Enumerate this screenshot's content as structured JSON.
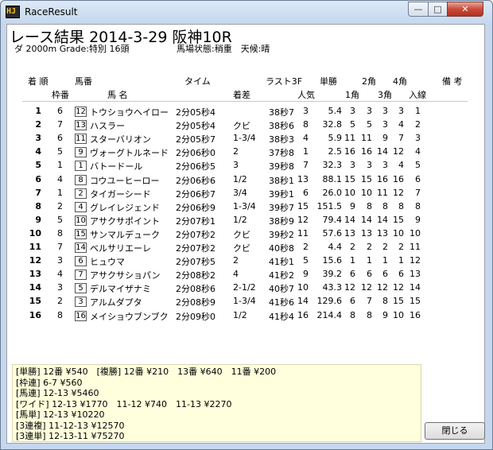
{
  "window": {
    "title": "RaceResult",
    "icon_text": "HJ"
  },
  "race": {
    "title": "レース結果 2014-3-29 阪神10R",
    "info_left": "ダ 2000m Grade:特別 16頭",
    "info_right": "馬場状態:稍重　天候:晴"
  },
  "headers": {
    "row1": [
      "着 順",
      "馬番",
      "タイム",
      "ラスト3F",
      "単勝",
      "2角",
      "4角",
      "備 考"
    ],
    "row2": [
      "枠番",
      "馬 名",
      "着差",
      "人気",
      "1角",
      "3角",
      "入線"
    ]
  },
  "results": [
    {
      "rank": "1",
      "waku": "6",
      "num": "12",
      "name": "トウショウヘイロー",
      "time": "2分05秒4",
      "margin": "",
      "last3f": "38秒7",
      "pop": "3",
      "odds": "5.4",
      "c1": "3",
      "c2": "3",
      "c3": "3",
      "c4": "3",
      "fin": "1"
    },
    {
      "rank": "2",
      "waku": "7",
      "num": "13",
      "name": "ハスラー",
      "time": "2分05秒4",
      "margin": "クビ",
      "last3f": "38秒6",
      "pop": "8",
      "odds": "32.8",
      "c1": "5",
      "c2": "5",
      "c3": "3",
      "c4": "4",
      "fin": "2"
    },
    {
      "rank": "3",
      "waku": "6",
      "num": "11",
      "name": "スターバリオン",
      "time": "2分05秒7",
      "margin": "1-3/4",
      "last3f": "38秒3",
      "pop": "4",
      "odds": "5.9",
      "c1": "11",
      "c2": "11",
      "c3": "9",
      "c4": "7",
      "fin": "3"
    },
    {
      "rank": "4",
      "waku": "5",
      "num": "9",
      "name": "ヴォーグトルネード",
      "time": "2分06秒0",
      "margin": "2",
      "last3f": "37秒8",
      "pop": "1",
      "odds": "2.5",
      "c1": "16",
      "c2": "16",
      "c3": "14",
      "c4": "12",
      "fin": "4"
    },
    {
      "rank": "5",
      "waku": "1",
      "num": "1",
      "name": "バトードール",
      "time": "2分06秒5",
      "margin": "3",
      "last3f": "39秒8",
      "pop": "7",
      "odds": "32.3",
      "c1": "3",
      "c2": "3",
      "c3": "3",
      "c4": "4",
      "fin": "5"
    },
    {
      "rank": "6",
      "waku": "4",
      "num": "8",
      "name": "コウユーヒーロー",
      "time": "2分06秒6",
      "margin": "1/2",
      "last3f": "38秒1",
      "pop": "13",
      "odds": "88.1",
      "c1": "15",
      "c2": "15",
      "c3": "16",
      "c4": "16",
      "fin": "6"
    },
    {
      "rank": "7",
      "waku": "1",
      "num": "2",
      "name": "タイガーシード",
      "time": "2分06秒7",
      "margin": "3/4",
      "last3f": "39秒1",
      "pop": "6",
      "odds": "26.0",
      "c1": "10",
      "c2": "10",
      "c3": "11",
      "c4": "12",
      "fin": "7"
    },
    {
      "rank": "8",
      "waku": "2",
      "num": "4",
      "name": "グレイレジェンド",
      "time": "2分06秒9",
      "margin": "1-3/4",
      "last3f": "39秒7",
      "pop": "15",
      "odds": "151.5",
      "c1": "9",
      "c2": "8",
      "c3": "8",
      "c4": "8",
      "fin": "8"
    },
    {
      "rank": "9",
      "waku": "5",
      "num": "10",
      "name": "アサクサポイント",
      "time": "2分07秒1",
      "margin": "1/2",
      "last3f": "38秒9",
      "pop": "12",
      "odds": "79.4",
      "c1": "14",
      "c2": "14",
      "c3": "14",
      "c4": "15",
      "fin": "9"
    },
    {
      "rank": "10",
      "waku": "8",
      "num": "15",
      "name": "サンマルデューク",
      "time": "2分07秒2",
      "margin": "クビ",
      "last3f": "39秒2",
      "pop": "11",
      "odds": "57.6",
      "c1": "13",
      "c2": "13",
      "c3": "13",
      "c4": "10",
      "fin": "10"
    },
    {
      "rank": "11",
      "waku": "7",
      "num": "14",
      "name": "ベルサリエーレ",
      "time": "2分07秒2",
      "margin": "クビ",
      "last3f": "40秒8",
      "pop": "2",
      "odds": "4.4",
      "c1": "2",
      "c2": "2",
      "c3": "2",
      "c4": "2",
      "fin": "11"
    },
    {
      "rank": "12",
      "waku": "3",
      "num": "6",
      "name": "ヒュウマ",
      "time": "2分07秒5",
      "margin": "2",
      "last3f": "41秒1",
      "pop": "5",
      "odds": "15.6",
      "c1": "1",
      "c2": "1",
      "c3": "1",
      "c4": "1",
      "fin": "12"
    },
    {
      "rank": "13",
      "waku": "4",
      "num": "7",
      "name": "アサクサショパン",
      "time": "2分08秒2",
      "margin": "4",
      "last3f": "41秒2",
      "pop": "9",
      "odds": "39.2",
      "c1": "6",
      "c2": "6",
      "c3": "6",
      "c4": "6",
      "fin": "13"
    },
    {
      "rank": "14",
      "waku": "3",
      "num": "5",
      "name": "デルマイザナミ",
      "time": "2分08秒6",
      "margin": "2-1/2",
      "last3f": "40秒7",
      "pop": "10",
      "odds": "43.3",
      "c1": "12",
      "c2": "12",
      "c3": "12",
      "c4": "12",
      "fin": "14"
    },
    {
      "rank": "15",
      "waku": "2",
      "num": "3",
      "name": "アルムダプタ",
      "time": "2分08秒9",
      "margin": "1-3/4",
      "last3f": "41秒6",
      "pop": "14",
      "odds": "129.6",
      "c1": "6",
      "c2": "7",
      "c3": "8",
      "c4": "15",
      "fin": "15"
    },
    {
      "rank": "16",
      "waku": "8",
      "num": "16",
      "name": "メイショウブンブク",
      "time": "2分09秒0",
      "margin": "1/2",
      "last3f": "41秒4",
      "pop": "16",
      "odds": "214.4",
      "c1": "8",
      "c2": "8",
      "c3": "9",
      "c4": "10",
      "fin": "16"
    }
  ],
  "payouts": [
    "[単勝] 12番 ¥540　[複勝] 12番 ¥210　13番 ¥640　11番 ¥200",
    "[枠連] 6-7 ¥560",
    "[馬連] 12-13 ¥5460",
    "[ワイド] 12-13 ¥1770　11-12 ¥740　11-13 ¥2270",
    "[馬単] 12-13 ¥10220",
    "[3連複] 11-12-13 ¥12570",
    "[3連単] 12-13-11 ¥75270"
  ],
  "buttons": {
    "close_label": "閉じる",
    "min_glyph": "—",
    "max_glyph": "□",
    "close_glyph": "✕"
  }
}
